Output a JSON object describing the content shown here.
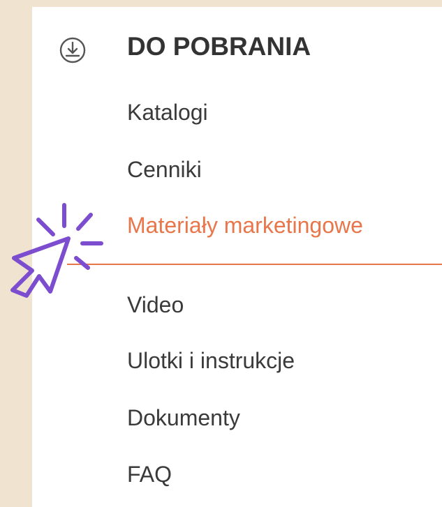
{
  "colors": {
    "background": "#f0e4d0",
    "panel": "#ffffff",
    "text": "#3a3a3a",
    "active": "#e8764a",
    "cursor_accent": "#7c4dcf"
  },
  "header": {
    "icon": "download-circle-icon",
    "title": "DO POBRANIA"
  },
  "menu": {
    "items": [
      {
        "label": "Katalogi",
        "active": false
      },
      {
        "label": "Cenniki",
        "active": false
      },
      {
        "label": "Materiały marketingowe",
        "active": true
      },
      {
        "label": "Video",
        "active": false
      },
      {
        "label": "Ulotki i instrukcje",
        "active": false
      },
      {
        "label": "Dokumenty",
        "active": false
      },
      {
        "label": "FAQ",
        "active": false
      }
    ]
  },
  "overlay": {
    "icon": "click-cursor-icon"
  }
}
